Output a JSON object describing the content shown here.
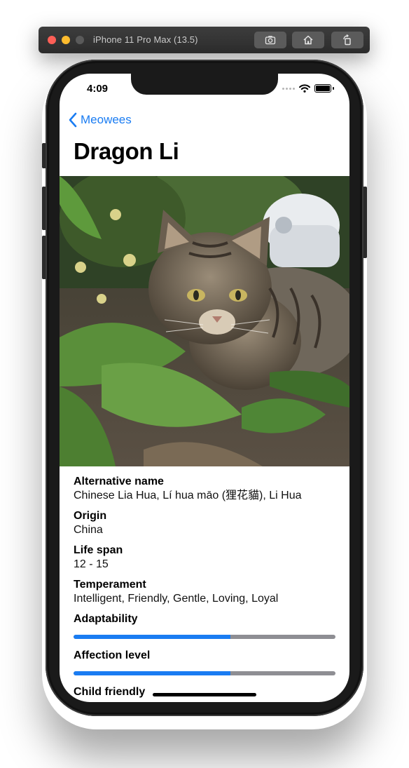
{
  "simulator": {
    "title": "iPhone 11 Pro Max (13.5)",
    "buttons": [
      "screenshot-icon",
      "home-icon",
      "rotate-icon"
    ]
  },
  "status_bar": {
    "time": "4:09",
    "icons": [
      "signal-dots-icon",
      "wifi-icon",
      "battery-icon"
    ]
  },
  "nav": {
    "back_label": "Meowees",
    "title": "Dragon Li"
  },
  "photo": {
    "subject": "tabby cat lying among green leaves"
  },
  "details": {
    "alternative_name": {
      "label": "Alternative name",
      "value": "Chinese Lia Hua, Lí hua māo (狸花貓), Li Hua"
    },
    "origin": {
      "label": "Origin",
      "value": "China"
    },
    "life_span": {
      "label": "Life span",
      "value": "12 - 15"
    },
    "temperament": {
      "label": "Temperament",
      "value": "Intelligent, Friendly, Gentle, Loving, Loyal"
    },
    "adaptability": {
      "label": "Adaptability",
      "level": 0.6
    },
    "affection_level": {
      "label": "Affection level",
      "level": 0.6
    },
    "child_friendly": {
      "label": "Child friendly"
    }
  },
  "colors": {
    "accent": "#1a7cf2",
    "bar_track": "#8e8e93"
  }
}
